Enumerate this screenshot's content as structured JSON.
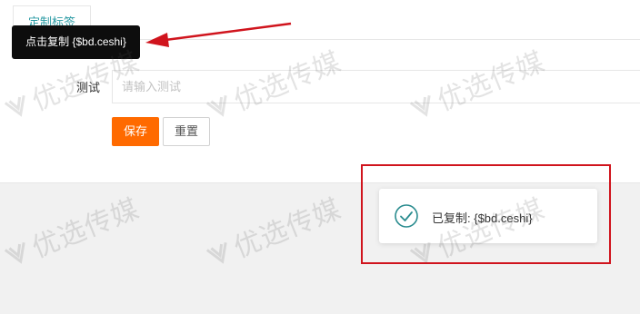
{
  "tabs": [
    {
      "label": "定制标签"
    }
  ],
  "tooltip": {
    "text": "点击复制 {$bd.ceshi}"
  },
  "form": {
    "label": "测试",
    "placeholder": "请输入测试",
    "value": ""
  },
  "buttons": {
    "save": "保存",
    "reset": "重置"
  },
  "toast": {
    "message": "已复制: {$bd.ceshi}",
    "icon": "check-circle-icon"
  },
  "watermark": {
    "text": "优选传媒",
    "icon": "watermark-logo-icon"
  },
  "colors": {
    "accent": "#ff6a00",
    "tab_text": "#2a9aa3",
    "annotation": "#d0141d",
    "toast_icon": "#2a8c8f"
  }
}
